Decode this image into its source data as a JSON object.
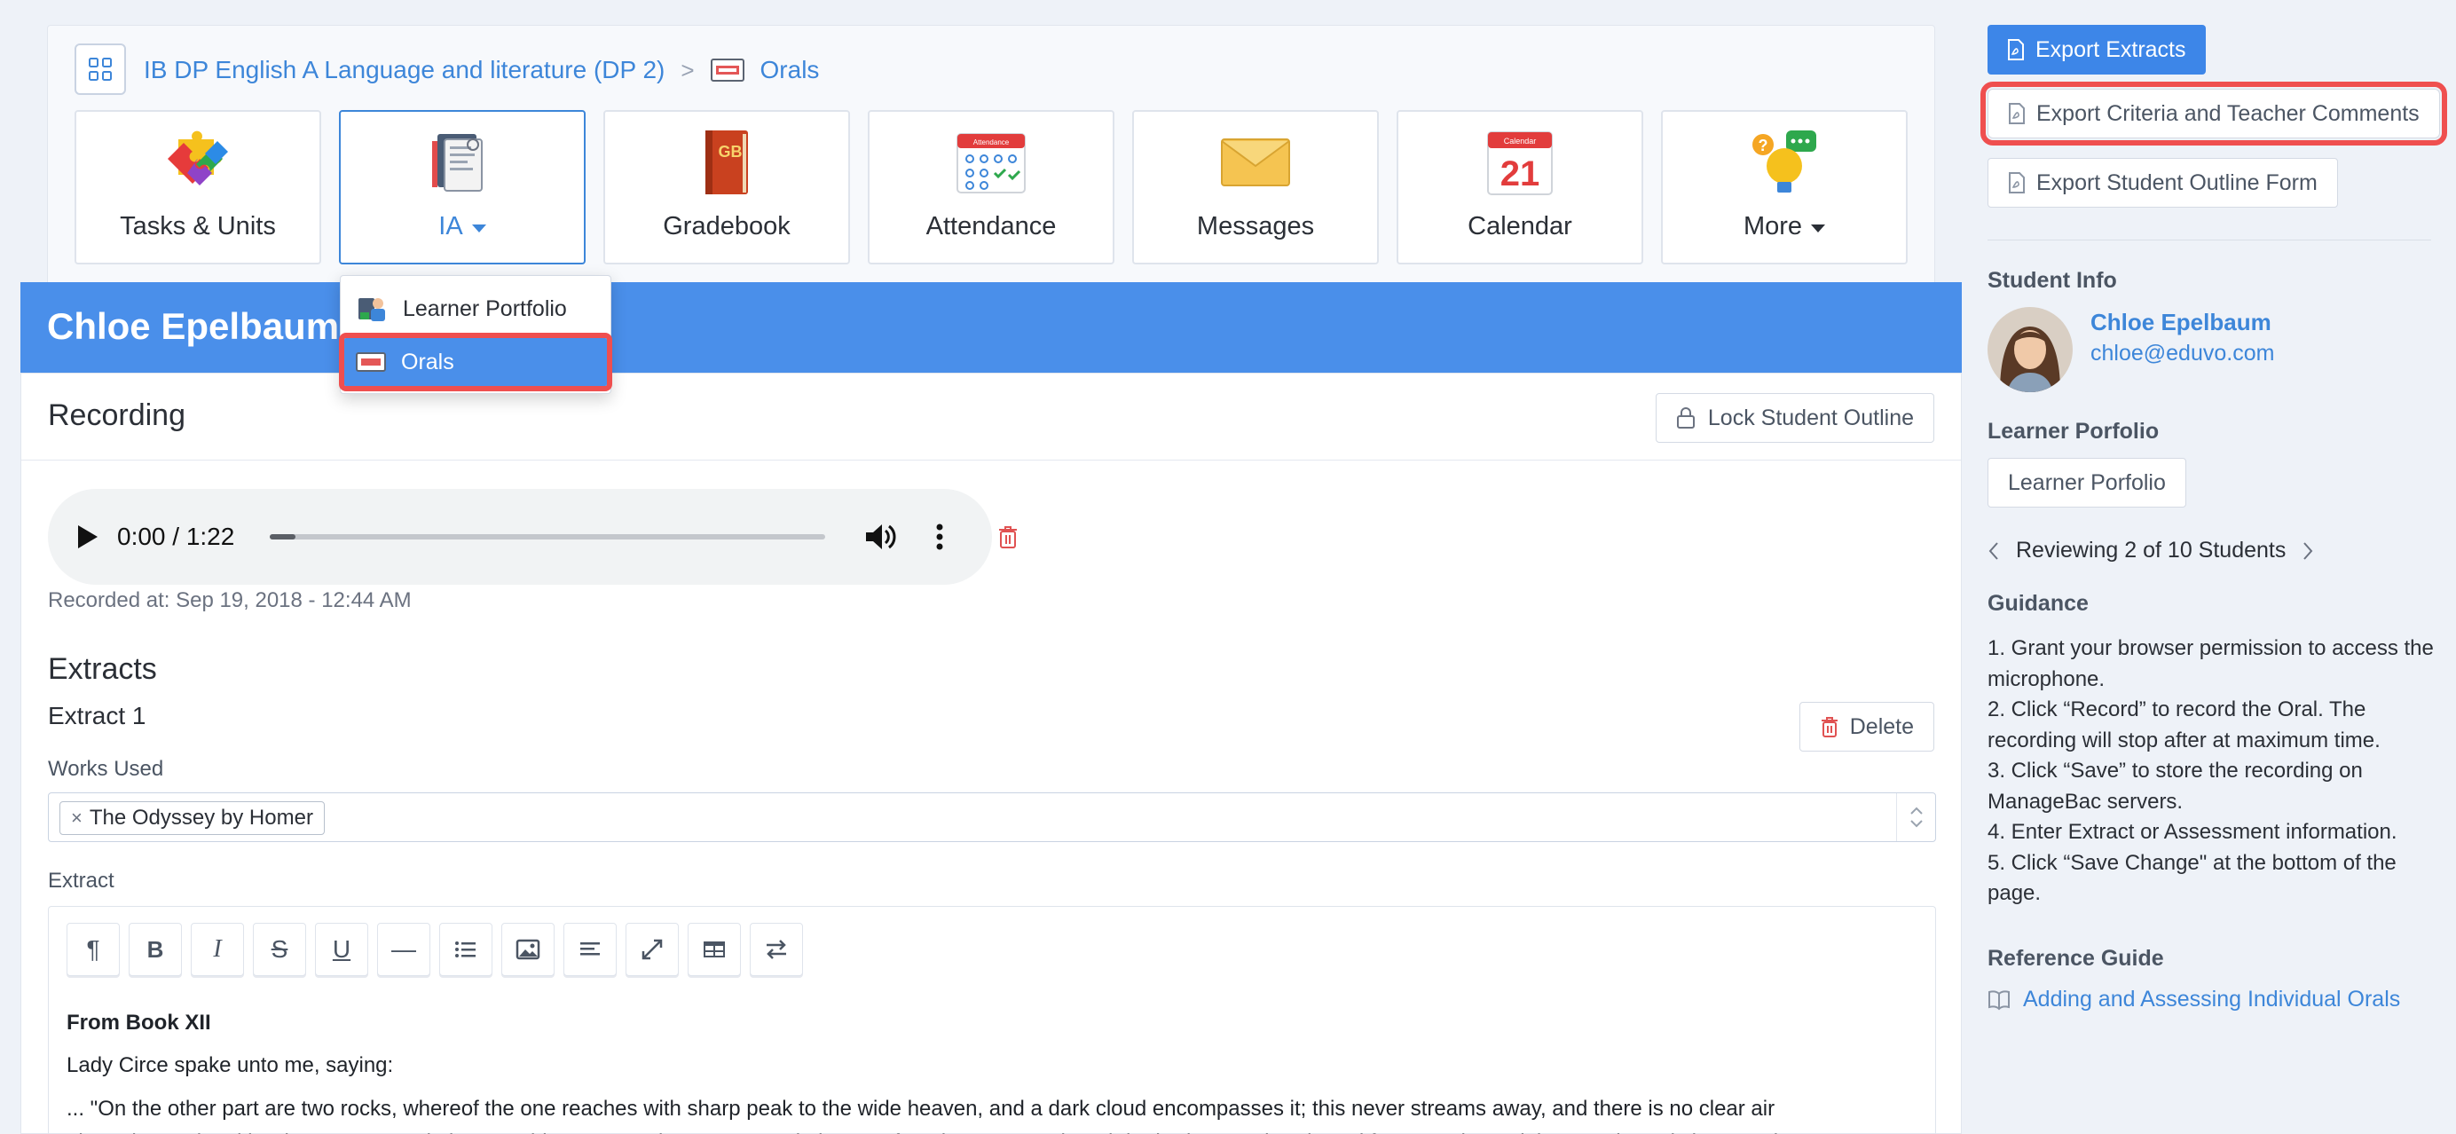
{
  "breadcrumb": {
    "course": "IB DP English A Language and literature (DP 2)",
    "separator": ">",
    "current": "Orals"
  },
  "nav": {
    "tiles": [
      {
        "label": "Tasks & Units",
        "icon": "puzzle-icon"
      },
      {
        "label": "IA",
        "icon": "ia-documents-icon",
        "active": true,
        "caret": true
      },
      {
        "label": "Gradebook",
        "icon": "gradebook-icon"
      },
      {
        "label": "Attendance",
        "icon": "attendance-icon"
      },
      {
        "label": "Messages",
        "icon": "envelope-icon"
      },
      {
        "label": "Calendar",
        "icon": "calendar-icon",
        "calendar_header": "Calendar",
        "calendar_day": "21"
      },
      {
        "label": "More",
        "icon": "lightbulb-icon",
        "caret": true
      }
    ],
    "gradebook_badge": "GB",
    "attendance_header": "Attendance"
  },
  "dropdown": {
    "items": [
      {
        "label": "Learner Portfolio",
        "icon": "learner-portfolio-icon"
      },
      {
        "label": "Orals",
        "icon": "orals-icon",
        "selected": true
      }
    ]
  },
  "student": {
    "name": "Chloe Epelbaum",
    "email": "chloe@eduvo.com"
  },
  "recording": {
    "title": "Recording",
    "lock_button": "Lock Student Outline",
    "player_time": "0:00 / 1:22",
    "progress": 0.045,
    "recorded_at": "Recorded at: Sep 19, 2018 - 12:44 AM"
  },
  "extracts": {
    "heading": "Extracts",
    "extract_title": "Extract 1",
    "delete_button": "Delete",
    "works_label": "Works Used",
    "works_chip": "The Odyssey by Homer",
    "chip_remove": "×",
    "extract_label": "Extract",
    "toolbar": [
      {
        "name": "paragraph-format-icon",
        "glyph": "¶"
      },
      {
        "name": "bold-icon",
        "glyph": "B"
      },
      {
        "name": "italic-icon",
        "glyph": "I"
      },
      {
        "name": "strikethrough-icon",
        "glyph": "S"
      },
      {
        "name": "underline-icon",
        "glyph": "U"
      },
      {
        "name": "horizontal-rule-icon",
        "glyph": "—"
      },
      {
        "name": "bullet-list-icon",
        "glyph": ""
      },
      {
        "name": "image-icon",
        "glyph": ""
      },
      {
        "name": "align-icon",
        "glyph": ""
      },
      {
        "name": "fullscreen-icon",
        "glyph": ""
      },
      {
        "name": "table-icon",
        "glyph": ""
      },
      {
        "name": "swap-icon",
        "glyph": ""
      }
    ],
    "text": {
      "heading": "From Book XII",
      "line1": "Lady Circe spake unto me, saying:",
      "line2": "... \"On the other part are two rocks, whereof the one reaches with sharp peak to the wide heaven, and a dark cloud encompasses it; this never streams away, and there is no clear air",
      "line3": "about the peak neither in summer nor in harvest tide. No mortal man may scale it or set foot thereon, not though he had twenty hands and feet. For the rock is smooth, and sheer, as it"
    }
  },
  "sidebar": {
    "export_extracts": "Export Extracts",
    "export_criteria": "Export Criteria and Teacher Comments",
    "export_outline": "Export Student Outline Form",
    "student_info_heading": "Student Info",
    "learner_portfolio_heading": "Learner Porfolio",
    "learner_portfolio_button": "Learner Porfolio",
    "reviewing": "Reviewing 2 of 10 Students",
    "guidance_heading": "Guidance",
    "guidance": [
      "1. Grant your browser permission to access the microphone.",
      "2. Click “Record” to record the Oral. The recording will stop after at maximum time.",
      "3. Click “Save” to store the recording on ManageBac servers.",
      "4. Enter Extract or Assessment information.",
      "5. Click “Save Change\" at the bottom of the page."
    ],
    "reference_heading": "Reference Guide",
    "reference_link": "Adding and Assessing Individual Orals"
  },
  "colors": {
    "accent": "#3d86d9",
    "banner": "#4a8fea",
    "highlight": "#ef4f4f",
    "danger": "#e05252"
  }
}
